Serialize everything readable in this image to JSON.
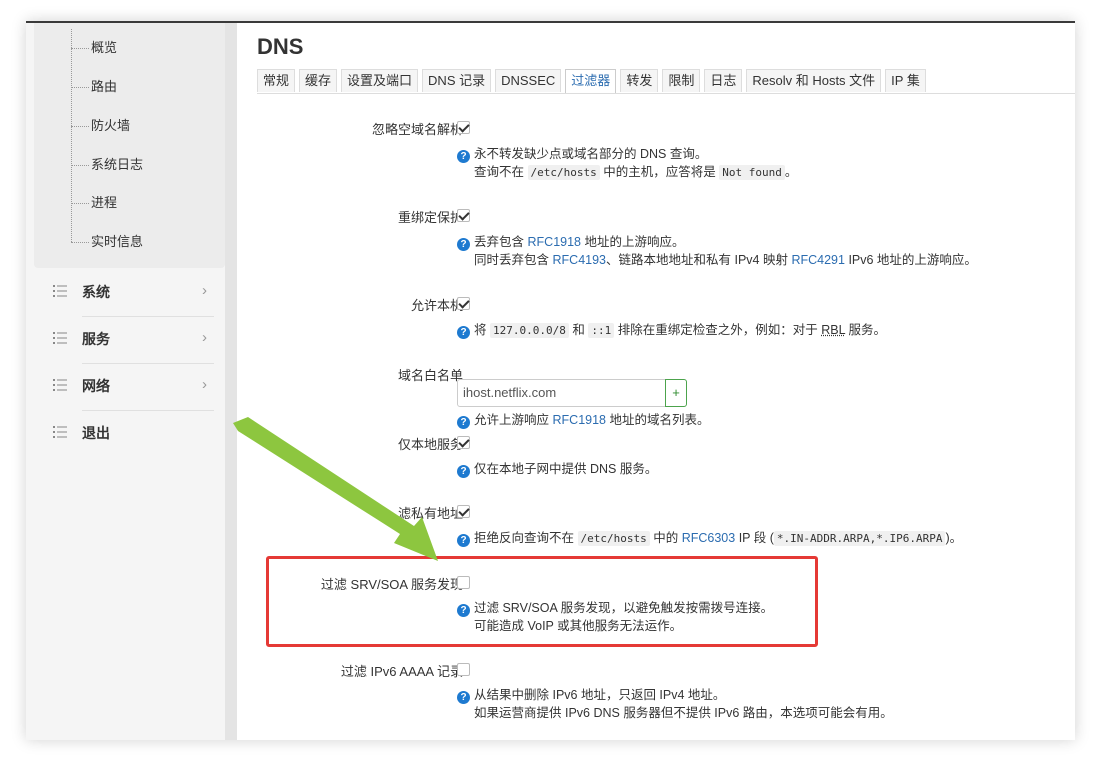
{
  "sidebar": {
    "sub_items": [
      "概览",
      "路由",
      "防火墙",
      "系统日志",
      "进程",
      "实时信息"
    ],
    "menus": [
      {
        "label": "系统",
        "has_arrow": true
      },
      {
        "label": "服务",
        "has_arrow": true
      },
      {
        "label": "网络",
        "has_arrow": true
      },
      {
        "label": "退出",
        "has_arrow": false
      }
    ]
  },
  "page": {
    "title": "DNS",
    "tabs": [
      "常规",
      "缓存",
      "设置及端口",
      "DNS 记录",
      "DNSSEC",
      "过滤器",
      "转发",
      "限制",
      "日志",
      "Resolv 和 Hosts 文件",
      "IP 集"
    ],
    "active_tab": "过滤器"
  },
  "settings": {
    "ignore_empty": {
      "label": "忽略空域名解析",
      "checked": true,
      "help1": "永不转发缺少点或域名部分的 DNS 查询。",
      "help2_a": "查询不在",
      "help2_code1": "/etc/hosts",
      "help2_b": "中的主机，应答将是",
      "help2_code2": "Not found",
      "help2_c": "。"
    },
    "rebind": {
      "label": "重绑定保护",
      "checked": true,
      "help1_a": "丢弃包含",
      "help1_link": "RFC1918",
      "help1_b": "地址的上游响应。",
      "help2_a": "同时丢弃包含",
      "help2_link1": "RFC4193",
      "help2_b": "、链路本地地址和私有 IPv4 映射",
      "help2_link2": "RFC4291",
      "help2_c": "IPv6 地址的上游响应。"
    },
    "localhost": {
      "label": "允许本机",
      "checked": true,
      "help_a": "将",
      "help_code1": "127.0.0.0/8",
      "help_b": "和",
      "help_code2": "::1",
      "help_c": "排除在重绑定检查之外，例如：对于",
      "help_abbr": "RBL",
      "help_d": "服务。"
    },
    "whitelist": {
      "label": "域名白名单",
      "value": "ihost.netflix.com",
      "add_label": "+",
      "help_a": "允许上游响应",
      "help_link": "RFC1918",
      "help_b": "地址的域名列表。"
    },
    "local_service": {
      "label": "仅本地服务",
      "checked": true,
      "help": "仅在本地子网中提供 DNS 服务。"
    },
    "private": {
      "label": "滤私有地址",
      "checked": true,
      "help_a": "拒绝反向查询不在",
      "help_code1": "/etc/hosts",
      "help_b": "中的",
      "help_link": "RFC6303",
      "help_c": "IP 段 (",
      "help_code2": "*.IN-ADDR.ARPA,*.IP6.ARPA",
      "help_d": ")。"
    },
    "srv_soa": {
      "label": "过滤 SRV/SOA 服务发现",
      "checked": false,
      "help1": "过滤 SRV/SOA 服务发现，以避免触发按需拨号连接。",
      "help2": "可能造成 VoIP 或其他服务无法运作。"
    },
    "aaaa": {
      "label": "过滤 IPv6 AAAA 记录",
      "checked": false,
      "help1": "从结果中删除 IPv6 地址，只返回 IPv4 地址。",
      "help2": "如果运营商提供 IPv6 DNS 服务器但不提供 IPv6 路由，本选项可能会有用。"
    }
  },
  "annotation": {
    "arrow_color": "#8dc63f",
    "box_color": "#e53935"
  }
}
